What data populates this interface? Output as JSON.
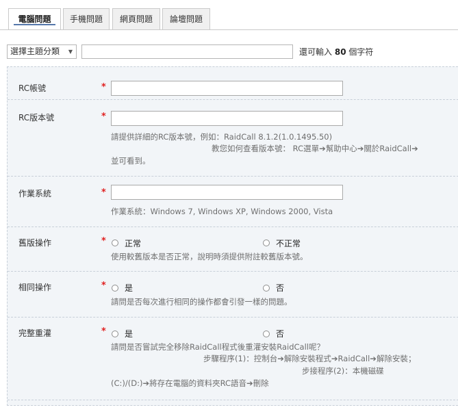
{
  "tabs": [
    {
      "label": "電腦問題",
      "active": true
    },
    {
      "label": "手機問題",
      "active": false
    },
    {
      "label": "網頁問題",
      "active": false
    },
    {
      "label": "論壇問題",
      "active": false
    }
  ],
  "subject": {
    "select_value": "選擇主題分類",
    "input_value": "",
    "remaining_prefix": "還可輸入",
    "remaining_count": "80",
    "remaining_suffix": "個字符"
  },
  "form": {
    "required_mark": "*",
    "rc_account": {
      "label": "RC帳號",
      "value": ""
    },
    "rc_version": {
      "label": "RC版本號",
      "value": "",
      "hint_line1": "請提供詳細的RC版本號，例如：RaidCall 8.1.2(1.0.1495.50)",
      "hint_line2": "教您如何查看版本號：  RC選單➔幫助中心➔關於RaidCall➔",
      "hint_line3": "並可看到。"
    },
    "os": {
      "label": "作業系統",
      "value": "",
      "hint": "作業系統：Windows 7, Windows XP, Windows 2000, Vista"
    },
    "old_version": {
      "label": "舊版操作",
      "option1": "正常",
      "option2": "不正常",
      "hint": "使用較舊版本是否正常，說明時須提供附註較舊版本號。"
    },
    "same_operation": {
      "label": "相同操作",
      "option1": "是",
      "option2": "否",
      "hint": "請問是否每次進行相同的操作都會引發一樣的問題。"
    },
    "full_reinstall": {
      "label": "完整重灌",
      "option1": "是",
      "option2": "否",
      "hint_line1": "請問是否嘗試完全移除RaidCall程式後重灌安裝RaidCall呢？",
      "hint_line2": "步驟程序(1)：控制台➔解除安裝程式➔RaidCall➔解除安裝；",
      "hint_line3": "步接程序(2)：本機磁碟",
      "hint_line4": "(C:)/(D:)➔將存在電腦的資料夾RC語音➔刪除"
    }
  }
}
